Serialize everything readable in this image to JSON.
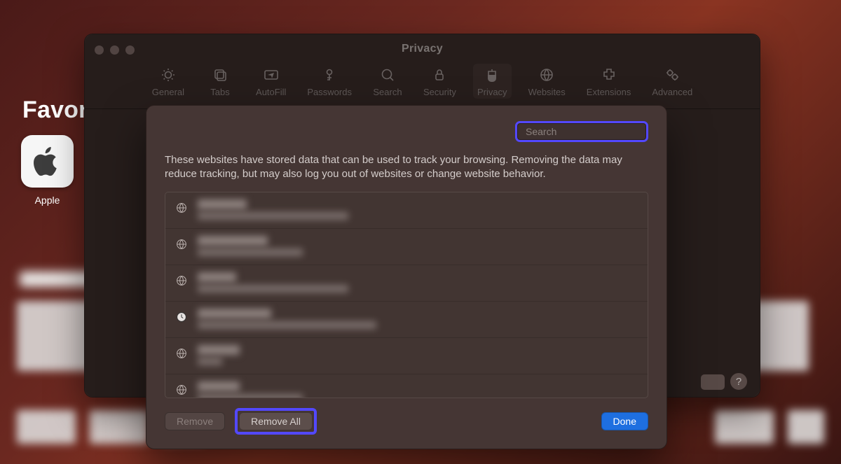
{
  "start_page": {
    "heading": "Favorites",
    "bookmark": {
      "label": "Apple"
    }
  },
  "preferences": {
    "title": "Privacy",
    "toolbar": [
      {
        "id": "general",
        "label": "General"
      },
      {
        "id": "tabs",
        "label": "Tabs"
      },
      {
        "id": "autofill",
        "label": "AutoFill"
      },
      {
        "id": "passwords",
        "label": "Passwords"
      },
      {
        "id": "search",
        "label": "Search"
      },
      {
        "id": "security",
        "label": "Security"
      },
      {
        "id": "privacy",
        "label": "Privacy",
        "active": true
      },
      {
        "id": "websites",
        "label": "Websites"
      },
      {
        "id": "extensions",
        "label": "Extensions"
      },
      {
        "id": "advanced",
        "label": "Advanced"
      }
    ],
    "help": "?"
  },
  "sheet": {
    "search": {
      "placeholder": "Search",
      "value": ""
    },
    "message": "These websites have stored data that can be used to track your browsing. Removing the data may reduce tracking, but may also log you out of websites or change website behavior.",
    "sites": [
      {
        "icon": "globe",
        "w1": 70,
        "w2": 215
      },
      {
        "icon": "globe",
        "w1": 100,
        "w2": 150
      },
      {
        "icon": "globe",
        "w1": 55,
        "w2": 215
      },
      {
        "icon": "history",
        "w1": 105,
        "w2": 255
      },
      {
        "icon": "globe",
        "w1": 60,
        "w2": 35
      },
      {
        "icon": "globe",
        "w1": 60,
        "w2": 150
      },
      {
        "icon": "globe",
        "w1": 100,
        "w2": 125
      }
    ],
    "buttons": {
      "remove": "Remove",
      "remove_all": "Remove All",
      "done": "Done"
    }
  }
}
